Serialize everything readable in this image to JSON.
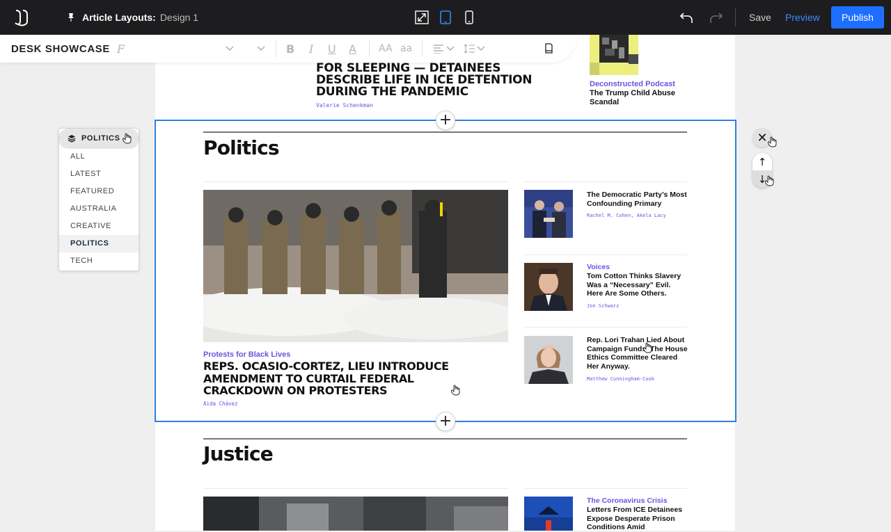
{
  "topbar": {
    "doc_label": "Article Layouts:",
    "doc_name": "Design 1",
    "save": "Save",
    "preview": "Preview",
    "publish": "Publish",
    "colors": {
      "bg": "#1d1d1f",
      "publish": "#1e6fff",
      "preview": "#3d8bff"
    }
  },
  "toolbar": {
    "desk_title": "DESK SHOWCASE",
    "font_icon": "F",
    "bold": "B",
    "italic": "I",
    "underline": "U",
    "color": "A",
    "uppercase": "AA",
    "lowercase": "aa"
  },
  "top_article": {
    "headline": "FOR SLEEPING — DETAINEES DESCRIBE LIFE IN ICE DETENTION DURING THE PANDEMIC",
    "author": "Valerie Schenkman",
    "podcast_label": "Deconstructed Podcast",
    "podcast_title": "The Trump Child Abuse Scandal"
  },
  "politics": {
    "section_title": "Politics",
    "main": {
      "kicker": "Protests for Black Lives",
      "headline": "REPS. OCASIO-CORTEZ, LIEU INTRODUCE AMENDMENT TO CURTAIL FEDERAL CRACKDOWN ON PROTESTERS",
      "author": "Aida Chávez"
    },
    "side": [
      {
        "kicker": "",
        "title": "The Democratic Party’s Most Confounding Primary",
        "author": "Rachel M. Cohen, Akela Lacy"
      },
      {
        "kicker": "Voices",
        "title": "Tom Cotton Thinks Slavery Was a “Necessary” Evil. Here Are Some Others.",
        "author": "Jon Schwarz"
      },
      {
        "kicker": "",
        "title": "Rep. Lori Trahan Lied About Campaign Funds. The House Ethics Committee Cleared Her Anyway.",
        "author": "Matthew Cunningham-Cook"
      }
    ]
  },
  "justice": {
    "section_title": "Justice",
    "side_kicker": "The Coronavirus Crisis",
    "side_title": "Letters From ICE Detainees Expose Desperate Prison Conditions Amid"
  },
  "category_dropdown": {
    "selected": "POLITICS",
    "items": [
      "ALL",
      "LATEST",
      "FEATURED",
      "AUSTRALIA",
      "CREATIVE",
      "POLITICS",
      "TECH"
    ]
  },
  "controls": {
    "close": "✕",
    "add": "+",
    "move_up": "↑",
    "move_down": "↓"
  }
}
